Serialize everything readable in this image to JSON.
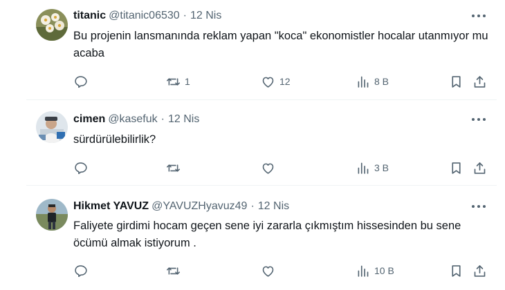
{
  "replies": [
    {
      "name": "titanic",
      "handle": "@titanic06530",
      "separator": "·",
      "date": "12 Nis",
      "text": "Bu projenin lansmanında reklam yapan \"koca\" ekonomistler hocalar utanmıyor mu acaba",
      "retweets": "1",
      "likes": "12",
      "views": "8 B"
    },
    {
      "name": "cimen",
      "handle": "@kasefuk",
      "separator": "·",
      "date": "12 Nis",
      "text": "sürdürülebilirlik?",
      "retweets": "",
      "likes": "",
      "views": "3 B"
    },
    {
      "name": "Hikmet YAVUZ",
      "handle": "@YAVUZHyavuz49",
      "separator": "·",
      "date": "12 Nis",
      "text": "Faliyete girdimi hocam geçen sene iyi zararla çıkmıştım hissesinden bu sene öcümü almak istiyorum .",
      "retweets": "",
      "likes": "",
      "views": "10 B"
    }
  ],
  "colors": {
    "text": "#0f1419",
    "secondary": "#536471",
    "divider": "#eff3f4"
  },
  "icons": [
    "reply-icon",
    "retweet-icon",
    "like-icon",
    "views-icon",
    "bookmark-icon",
    "share-icon",
    "more-icon"
  ]
}
